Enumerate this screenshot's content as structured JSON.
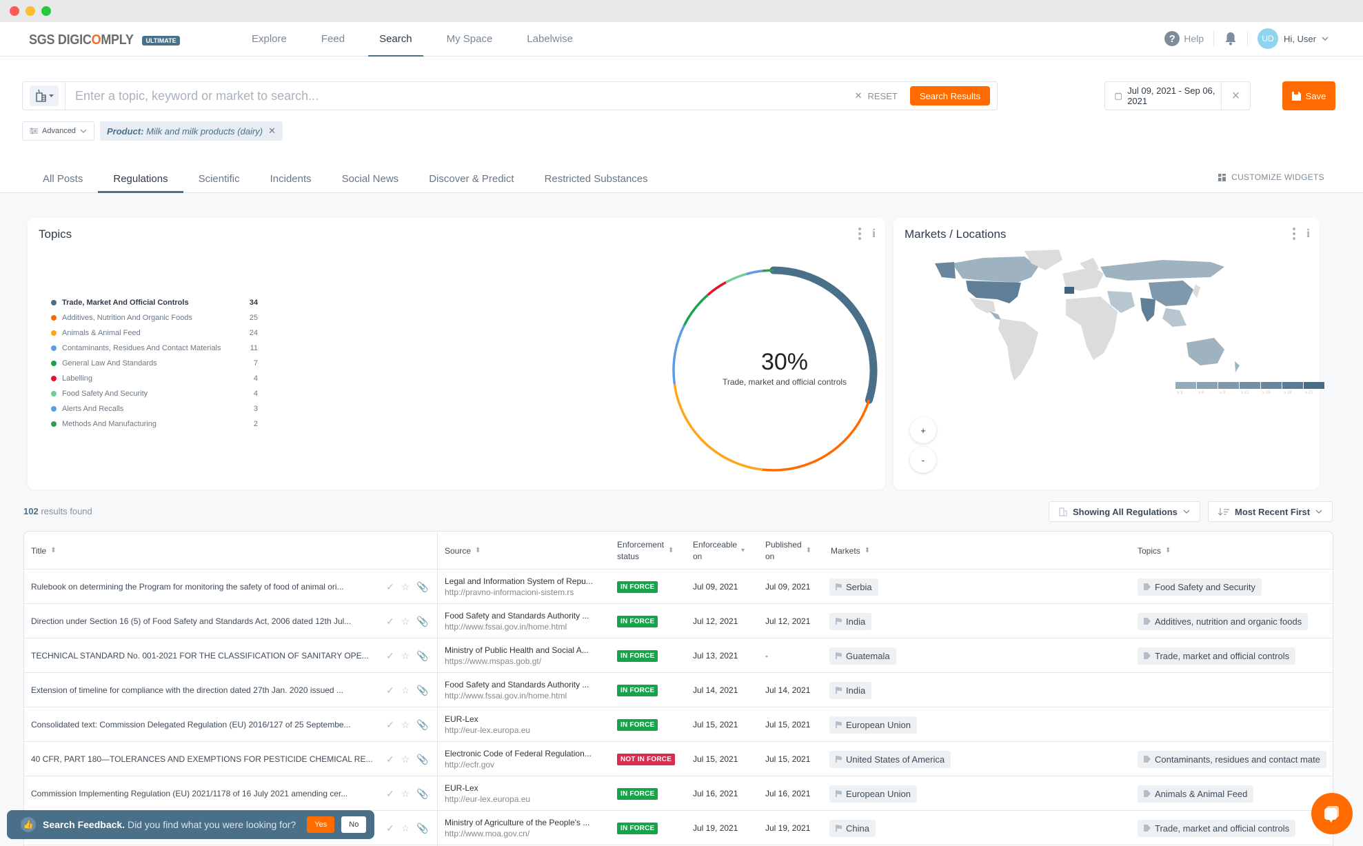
{
  "window": {
    "controls": [
      "close",
      "minimize",
      "maximize"
    ]
  },
  "brand": {
    "name_prefix": "SGS DIGIC",
    "name_o": "O",
    "name_suffix": "MPLY",
    "badge": "ULTIMATE"
  },
  "nav": {
    "links": [
      {
        "label": "Explore",
        "active": false
      },
      {
        "label": "Feed",
        "active": false
      },
      {
        "label": "Search",
        "active": true
      },
      {
        "label": "My Space",
        "active": false
      },
      {
        "label": "Labelwise",
        "active": false
      }
    ],
    "help_label": "Help",
    "avatar_initials": "UD",
    "greeting": "Hi, User"
  },
  "search": {
    "placeholder": "Enter a topic, keyword or market to search...",
    "value": "",
    "reset_label": "RESET",
    "submit_label": "Search Results",
    "date_range": "Jul 09, 2021 - Sep 06, 2021",
    "save_label": "Save",
    "advanced_label": "Advanced",
    "filter_key": "Product:",
    "filter_value": "Milk and milk products (dairy)"
  },
  "tabs": [
    {
      "label": "All Posts",
      "active": false
    },
    {
      "label": "Regulations",
      "active": true
    },
    {
      "label": "Scientific",
      "active": false
    },
    {
      "label": "Incidents",
      "active": false
    },
    {
      "label": "Social News",
      "active": false
    },
    {
      "label": "Discover & Predict",
      "active": false
    },
    {
      "label": "Restricted Substances",
      "active": false
    }
  ],
  "customize_label": "CUSTOMIZE WIDGETS",
  "topics_widget": {
    "title": "Topics",
    "center_percent": "30%",
    "center_label": "Trade, market and official controls"
  },
  "chart_data": {
    "type": "pie",
    "title": "Topics",
    "categories": [
      "Trade, Market And Official Controls",
      "Additives, Nutrition And Organic Foods",
      "Animals & Animal Feed",
      "Contaminants, Residues And Contact Materials",
      "General Law And Standards",
      "Labelling",
      "Food Safety And Security",
      "Alerts And Recalls",
      "Methods And Manufacturing"
    ],
    "values": [
      34,
      25,
      24,
      11,
      7,
      4,
      4,
      3,
      2
    ],
    "colors": [
      "#4a6f88",
      "#ff6b00",
      "#ffa41b",
      "#5c9be6",
      "#16a34a",
      "#e8112d",
      "#6fcf97",
      "#5c9be6",
      "#2e9e4f"
    ],
    "highlight": {
      "category": "Trade, Market And Official Controls",
      "percent": 30
    },
    "legend": "left"
  },
  "markets_widget": {
    "title": "Markets / Locations",
    "scale_labels": [
      "≥ 3",
      "≥ 6",
      "≥ 9",
      "≥ 12",
      "≥ 15",
      "≥ 18",
      "≥ 21"
    ],
    "scale_colors": [
      "#94aab9",
      "#8aa1b2",
      "#7f98ab",
      "#748fa4",
      "#69869d",
      "#5b7a93",
      "#476c86"
    ],
    "zoom_in": "+",
    "zoom_out": "-"
  },
  "results": {
    "count": "102",
    "count_suffix": "results found",
    "filter_dropdown": "Showing All Regulations",
    "sort_dropdown": "Most Recent First"
  },
  "table": {
    "columns": {
      "title": "Title",
      "source": "Source",
      "enforcement_status_1": "Enforcement",
      "enforcement_status_2": "status",
      "enforceable_on_1": "Enforceable",
      "enforceable_on_2": "on",
      "published_on_1": "Published",
      "published_on_2": "on",
      "markets": "Markets",
      "topics": "Topics"
    },
    "rows": [
      {
        "title": "Rulebook on determining the Program for monitoring the safety of food of animal ori...",
        "source": "Legal and Information System of Repu...",
        "url": "http://pravno-informacioni-sistem.rs",
        "status": "IN FORCE",
        "status_type": "in",
        "enforceable": "Jul 09, 2021",
        "published": "Jul 09, 2021",
        "market": "Serbia",
        "topic": "Food Safety and Security"
      },
      {
        "title": "Direction under Section 16 (5) of Food Safety and Standards Act, 2006 dated 12th Jul...",
        "source": "Food Safety and Standards Authority ...",
        "url": "http://www.fssai.gov.in/home.html",
        "status": "IN FORCE",
        "status_type": "in",
        "enforceable": "Jul 12, 2021",
        "published": "Jul 12, 2021",
        "market": "India",
        "topic": "Additives, nutrition and organic foods"
      },
      {
        "title": "TECHNICAL STANDARD No. 001-2021 FOR THE CLASSIFICATION OF SANITARY OPE...",
        "source": "Ministry of Public Health and Social A...",
        "url": "https://www.mspas.gob.gt/",
        "status": "IN FORCE",
        "status_type": "in",
        "enforceable": "Jul 13, 2021",
        "published": "-",
        "market": "Guatemala",
        "topic": "Trade, market and official controls"
      },
      {
        "title": "Extension of timeline for compliance with the direction dated 27th Jan. 2020 issued ...",
        "source": "Food Safety and Standards Authority ...",
        "url": "http://www.fssai.gov.in/home.html",
        "status": "IN FORCE",
        "status_type": "in",
        "enforceable": "Jul 14, 2021",
        "published": "Jul 14, 2021",
        "market": "India",
        "topic": ""
      },
      {
        "title": "Consolidated text: Commission Delegated Regulation (EU) 2016/127 of 25 Septembe...",
        "source": "EUR-Lex",
        "url": "http://eur-lex.europa.eu",
        "status": "IN FORCE",
        "status_type": "in",
        "enforceable": "Jul 15, 2021",
        "published": "Jul 15, 2021",
        "market": "European Union",
        "topic": ""
      },
      {
        "title": "40 CFR, PART 180—TOLERANCES AND EXEMPTIONS FOR PESTICIDE CHEMICAL RE...",
        "source": "Electronic Code of Federal Regulation...",
        "url": "http://ecfr.gov",
        "status": "NOT IN FORCE",
        "status_type": "not",
        "enforceable": "Jul 15, 2021",
        "published": "Jul 15, 2021",
        "market": "United States of America",
        "topic": "Contaminants, residues and contact mate"
      },
      {
        "title": "Commission Implementing Regulation (EU) 2021/1178 of 16 July 2021 amending cer...",
        "source": "EUR-Lex",
        "url": "http://eur-lex.europa.eu",
        "status": "IN FORCE",
        "status_type": "in",
        "enforceable": "Jul 16, 2021",
        "published": "Jul 16, 2021",
        "market": "European Union",
        "topic": "Animals & Animal Feed"
      },
      {
        "title": "",
        "source": "Ministry of Agriculture of the People's ...",
        "url": "http://www.moa.gov.cn/",
        "status": "IN FORCE",
        "status_type": "in",
        "enforceable": "Jul 19, 2021",
        "published": "Jul 19, 2021",
        "market": "China",
        "topic": "Trade, market and official controls"
      }
    ]
  },
  "feedback": {
    "title": "Search Feedback.",
    "question": "Did you find what you were looking for?",
    "yes": "Yes",
    "no": "No"
  }
}
